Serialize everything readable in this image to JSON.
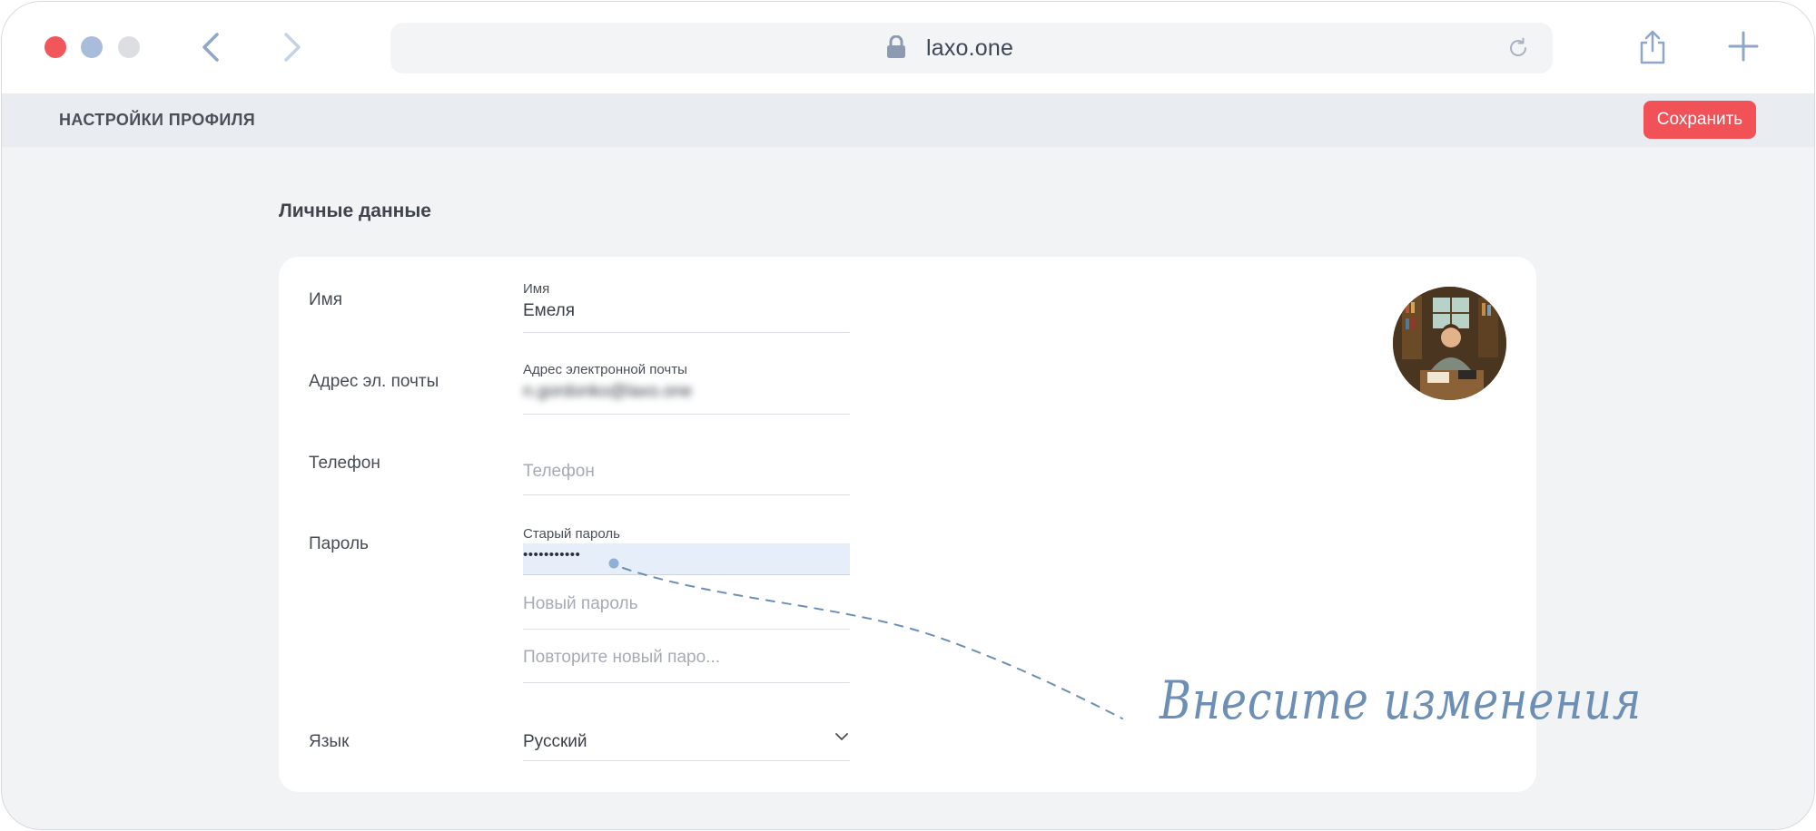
{
  "browser": {
    "url": "laxo.one"
  },
  "appbar": {
    "title": "НАСТРОЙКИ ПРОФИЛЯ",
    "save_label": "Сохранить"
  },
  "section": {
    "title": "Личные данные"
  },
  "form": {
    "name": {
      "label": "Имя",
      "field_label": "Имя",
      "value": "Емеля"
    },
    "email": {
      "label": "Адрес эл. почты",
      "field_label": "Адрес электронной почты",
      "value": "n.gordonko@laxo.one"
    },
    "phone": {
      "label": "Телефон",
      "placeholder": "Телефон"
    },
    "password": {
      "label": "Пароль",
      "old_label": "Старый пароль",
      "old_value": "•••••••••••",
      "new_placeholder": "Новый пароль",
      "repeat_placeholder": "Повторите новый паро..."
    },
    "language": {
      "label": "Язык",
      "value": "Русский"
    }
  },
  "annotation": "Внесите изменения",
  "colors": {
    "save_button": "#f05257",
    "annotation": "#6d8fb6",
    "focused_field": "#e6eef9"
  }
}
